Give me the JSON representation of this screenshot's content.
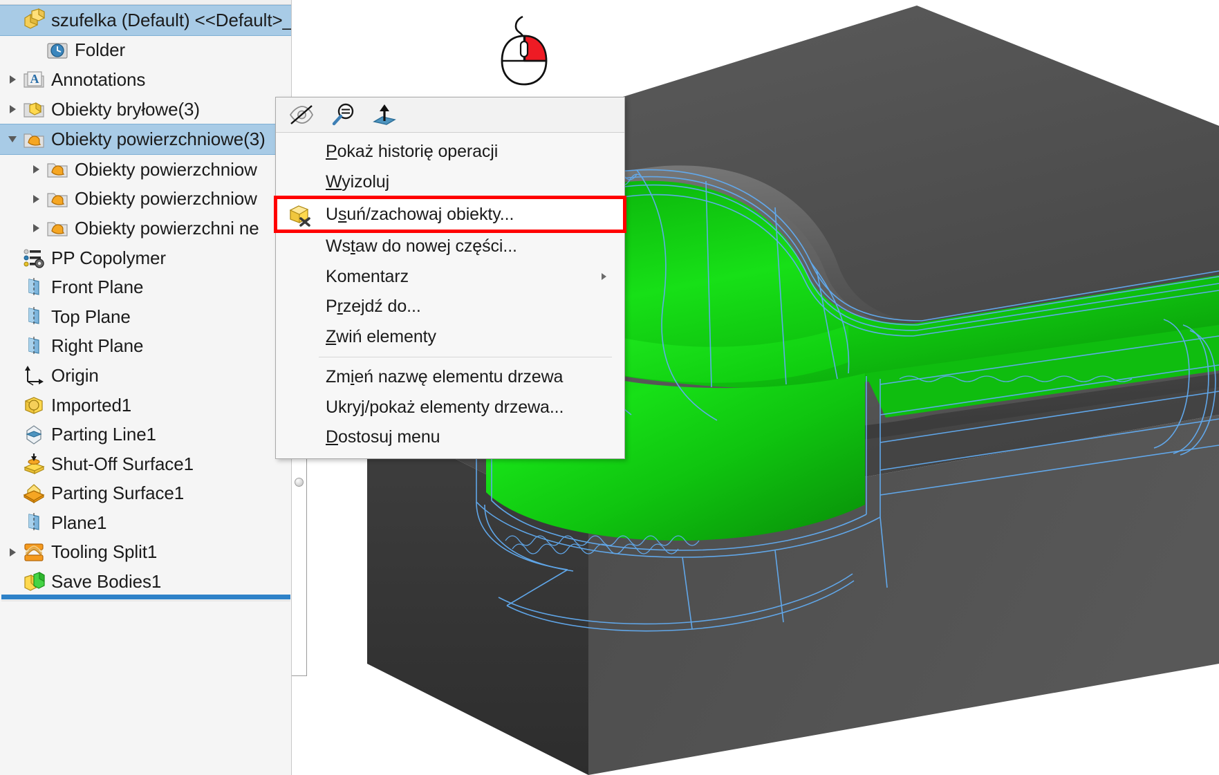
{
  "app": {
    "accent_blue": "#2e82c8",
    "selection_blue": "#a8cbe6",
    "highlight_red": "#ff0000",
    "model_green": "#12d012",
    "model_gray": "#4a4a4a",
    "wireframe_blue": "#5aa8f0"
  },
  "feature_tree": {
    "items": [
      {
        "label": "szufelka (Default) <<Default>_W",
        "icon": "part-body-icon",
        "indent": 0,
        "arrow": "none",
        "selected": true
      },
      {
        "label": "Folder",
        "icon": "history-folder-icon",
        "indent": 1,
        "arrow": "none",
        "selected": false
      },
      {
        "label": "Annotations",
        "icon": "annotations-folder-icon",
        "indent": 0,
        "arrow": "collapsed",
        "selected": false
      },
      {
        "label": "Obiekty bryłowe(3)",
        "icon": "solid-bodies-folder-icon",
        "indent": 0,
        "arrow": "collapsed",
        "selected": false
      },
      {
        "label": "Obiekty powierzchniowe(3)",
        "icon": "surface-bodies-folder-icon",
        "indent": 0,
        "arrow": "expanded",
        "selected": true
      },
      {
        "label": "Obiekty powierzchniow",
        "icon": "surface-bodies-folder-icon",
        "indent": 1,
        "arrow": "collapsed",
        "selected": false
      },
      {
        "label": "Obiekty powierzchniow",
        "icon": "surface-bodies-folder-icon",
        "indent": 1,
        "arrow": "collapsed",
        "selected": false
      },
      {
        "label": "Obiekty powierzchni ne",
        "icon": "surface-bodies-folder-icon",
        "indent": 1,
        "arrow": "collapsed",
        "selected": false
      },
      {
        "label": "PP Copolymer",
        "icon": "material-icon",
        "indent": 0,
        "arrow": "none",
        "selected": false
      },
      {
        "label": "Front Plane",
        "icon": "plane-icon",
        "indent": 0,
        "arrow": "none",
        "selected": false
      },
      {
        "label": "Top Plane",
        "icon": "plane-icon",
        "indent": 0,
        "arrow": "none",
        "selected": false
      },
      {
        "label": "Right Plane",
        "icon": "plane-icon",
        "indent": 0,
        "arrow": "none",
        "selected": false
      },
      {
        "label": "Origin",
        "icon": "origin-icon",
        "indent": 0,
        "arrow": "none",
        "selected": false
      },
      {
        "label": "Imported1",
        "icon": "imported-icon",
        "indent": 0,
        "arrow": "none",
        "selected": false
      },
      {
        "label": "Parting Line1",
        "icon": "parting-line-icon",
        "indent": 0,
        "arrow": "none",
        "selected": false
      },
      {
        "label": "Shut-Off Surface1",
        "icon": "shutoff-surface-icon",
        "indent": 0,
        "arrow": "none",
        "selected": false
      },
      {
        "label": "Parting Surface1",
        "icon": "parting-surface-icon",
        "indent": 0,
        "arrow": "none",
        "selected": false
      },
      {
        "label": "Plane1",
        "icon": "plane-icon",
        "indent": 0,
        "arrow": "none",
        "selected": false
      },
      {
        "label": "Tooling Split1",
        "icon": "tooling-split-icon",
        "indent": 0,
        "arrow": "collapsed",
        "selected": false
      },
      {
        "label": "Save Bodies1",
        "icon": "save-bodies-icon",
        "indent": 0,
        "arrow": "none",
        "selected": false
      }
    ]
  },
  "context_menu": {
    "toolbar": [
      {
        "name": "hide-show-icon",
        "title": "Ukryj/Pokaż"
      },
      {
        "name": "zoom-to-selection-icon",
        "title": "Powiększ do zaznaczenia"
      },
      {
        "name": "normal-to-icon",
        "title": "Prostopadle do"
      }
    ],
    "items": [
      {
        "label": "Pokaż historię operacji",
        "accel": "P",
        "icon": "none",
        "separator_before": false,
        "submenu": false,
        "highlighted": false
      },
      {
        "label": "Wyizoluj",
        "accel": "W",
        "icon": "none",
        "separator_before": false,
        "submenu": false,
        "highlighted": false
      },
      {
        "label": "Usuń/zachowaj obiekty...",
        "accel": "s",
        "icon": "delete-keep-bodies-icon",
        "separator_before": false,
        "submenu": false,
        "highlighted": true
      },
      {
        "label": "Wstaw do nowej części...",
        "accel": "t",
        "icon": "none",
        "separator_before": false,
        "submenu": false,
        "highlighted": false
      },
      {
        "label": "Komentarz",
        "accel": "",
        "icon": "none",
        "separator_before": false,
        "submenu": true,
        "highlighted": false
      },
      {
        "label": "Przejdź do...",
        "accel": "r",
        "icon": "none",
        "separator_before": false,
        "submenu": false,
        "highlighted": false
      },
      {
        "label": "Zwiń elementy",
        "accel": "Z",
        "icon": "none",
        "separator_before": false,
        "submenu": false,
        "highlighted": false
      },
      {
        "label": "Zmień nazwę elementu drzewa",
        "accel": "i",
        "icon": "none",
        "separator_before": true,
        "submenu": false,
        "highlighted": false
      },
      {
        "label": "Ukryj/pokaż elementy drzewa...",
        "accel": "j",
        "icon": "none",
        "separator_before": false,
        "submenu": false,
        "highlighted": false
      },
      {
        "label": "Dostosuj menu",
        "accel": "D",
        "icon": "none",
        "separator_before": false,
        "submenu": false,
        "highlighted": false
      }
    ]
  },
  "annotations": {
    "mouse": {
      "name": "mouse-right-click-icon",
      "highlighted_button": "right",
      "highlight_color": "#ee1b24"
    }
  }
}
